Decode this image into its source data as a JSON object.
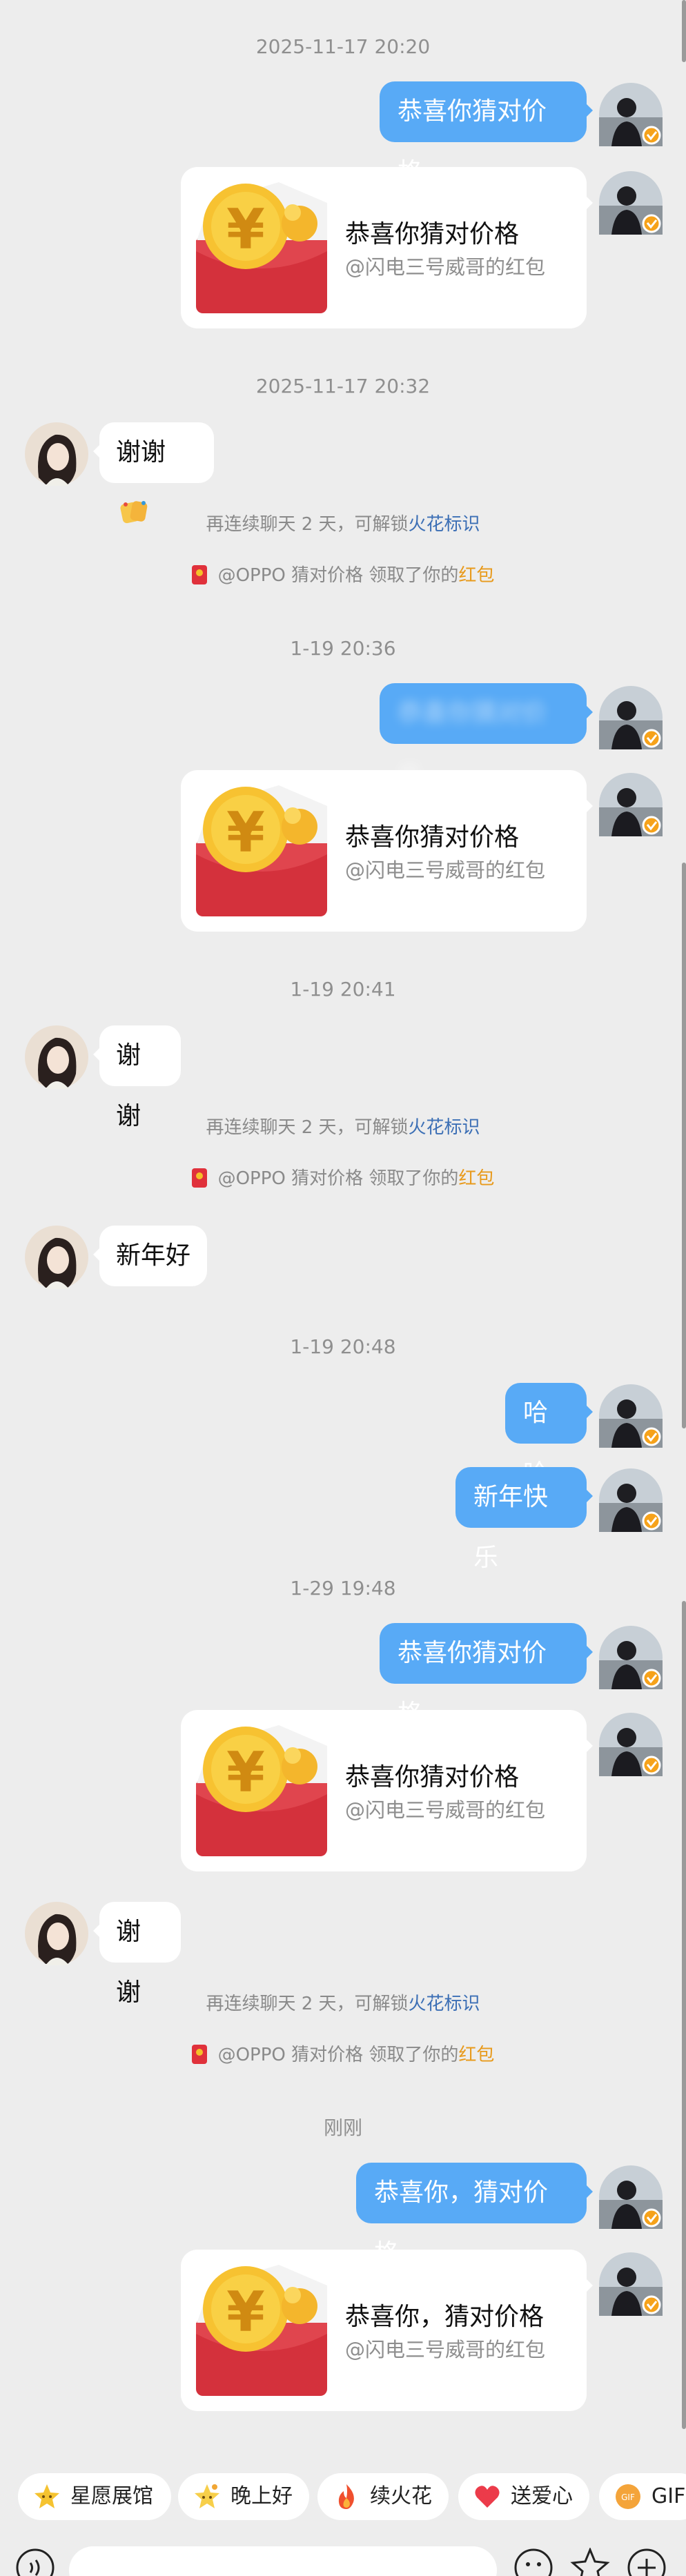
{
  "colors": {
    "background": "#ededed",
    "my_bubble": "#58aaf6",
    "link_blue": "#3c6fb5",
    "link_orange": "#e89a1c"
  },
  "messages": {
    "ts1": "2025-11-17 20:20",
    "m1": "恭喜你猜对价格",
    "card1": {
      "title": "恭喜你猜对价格",
      "sub": "@闪电三号威哥的红包"
    },
    "ts2": "2025-11-17 20:32",
    "h1": "谢谢",
    "sys1": {
      "prefix": "再连续聊天 2 天，可解锁",
      "link": "火花标识"
    },
    "rp1": {
      "prefix": "@OPPO 猜对价格 领取了你的",
      "link": "红包"
    },
    "ts3": "1-19 20:36",
    "m2": "恭喜你猜对价格",
    "card2": {
      "title": "恭喜你猜对价格",
      "sub": "@闪电三号威哥的红包"
    },
    "ts4": "1-19 20:41",
    "h2": "谢谢",
    "sys2": {
      "prefix": "再连续聊天 2 天，可解锁",
      "link": "火花标识"
    },
    "rp2": {
      "prefix": "@OPPO 猜对价格 领取了你的",
      "link": "红包"
    },
    "h3": "新年好",
    "ts5": "1-19 20:48",
    "m3": "哈哈",
    "m4": "新年快乐",
    "ts6": "1-29 19:48",
    "m5": "恭喜你猜对价格",
    "card3": {
      "title": "恭喜你猜对价格",
      "sub": "@闪电三号威哥的红包"
    },
    "h4": "谢谢",
    "sys3": {
      "prefix": "再连续聊天 2 天，可解锁",
      "link": "火花标识"
    },
    "rp3": {
      "prefix": "@OPPO 猜对价格 领取了你的",
      "link": "红包"
    },
    "ts7": "刚刚",
    "m6": "恭喜你，猜对价格",
    "card4": {
      "title": "恭喜你，猜对价格",
      "sub": "@闪电三号威哥的红包"
    }
  },
  "quick_chips": [
    {
      "label": "星愿展馆",
      "icon": "star-face-icon"
    },
    {
      "label": "晚上好",
      "icon": "star-night-icon"
    },
    {
      "label": "续火花",
      "icon": "flame-icon"
    },
    {
      "label": "送爱心",
      "icon": "heart-icon"
    },
    {
      "label": "GIF",
      "icon": "gif-icon"
    }
  ],
  "input_bar": {
    "icons": [
      "voice-icon",
      "emoji-icon",
      "sticker-icon",
      "add-icon"
    ]
  }
}
